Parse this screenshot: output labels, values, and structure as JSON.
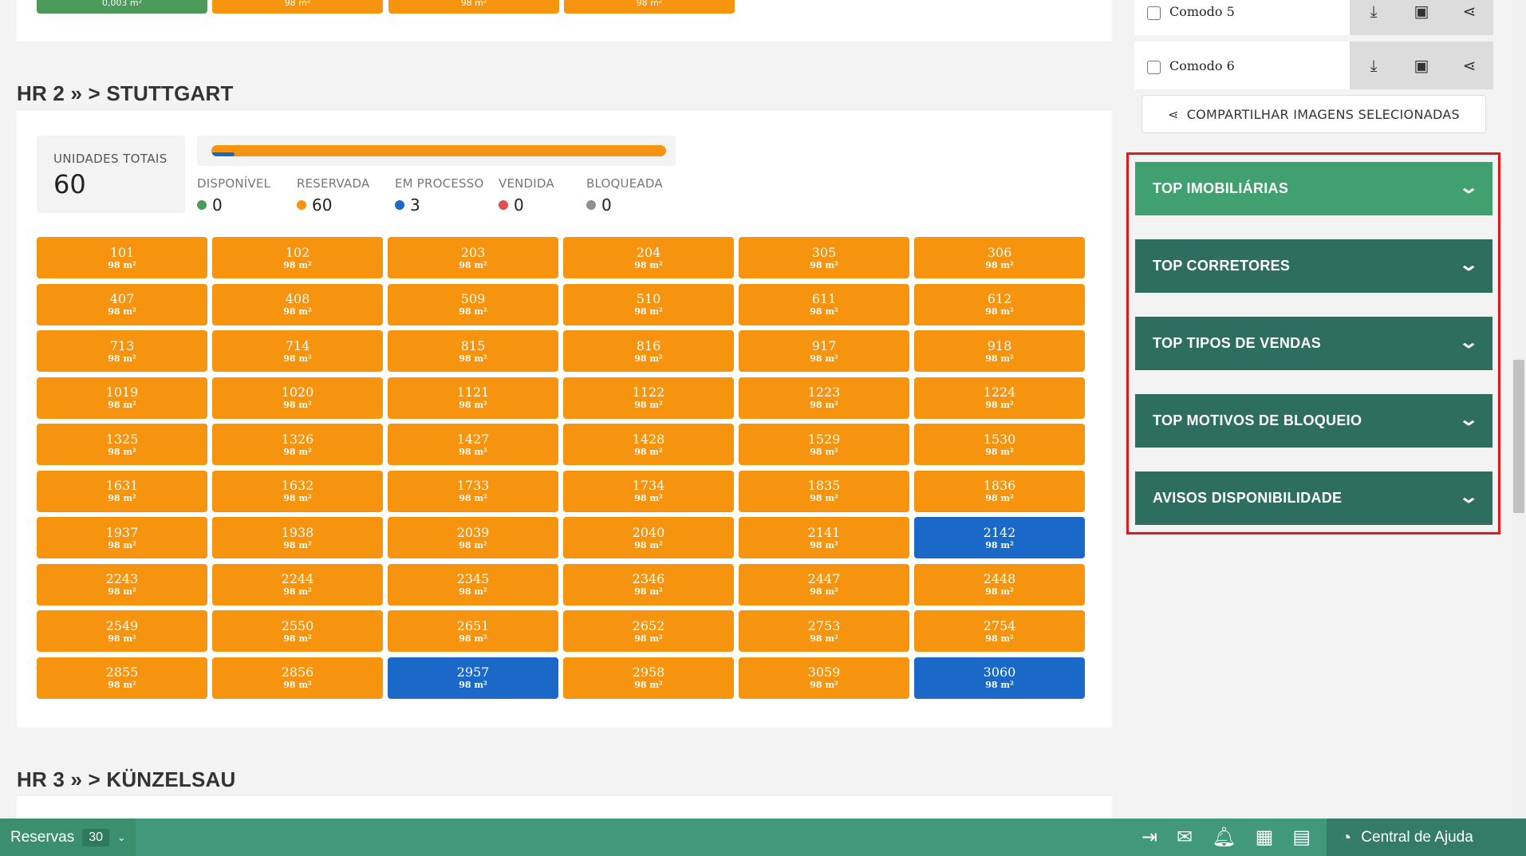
{
  "top_remnant": {
    "units": [
      {
        "area": "0,003 m²",
        "color": "green"
      },
      {
        "area": "98 m²",
        "color": "orange"
      },
      {
        "area": "98 m²",
        "color": "orange"
      },
      {
        "area": "98 m²",
        "color": "orange"
      }
    ]
  },
  "section_hr2": {
    "title": "HR 2 » > STUTTGART"
  },
  "totals": {
    "label": "UNIDADES TOTAIS",
    "value": "60"
  },
  "progress": {
    "reservada_fraction": 1.0,
    "em_processo_fraction": 0.05
  },
  "stats": [
    {
      "label": "DISPONÍVEL",
      "value": "0",
      "color": "#4c9a59"
    },
    {
      "label": "RESERVADA",
      "value": "60",
      "color": "#f6940f"
    },
    {
      "label": "EM PROCESSO",
      "value": "3",
      "color": "#1a69c9"
    },
    {
      "label": "VENDIDA",
      "value": "0",
      "color": "#e04f4f"
    },
    {
      "label": "BLOQUEADA",
      "value": "0",
      "color": "#8e8e8e"
    }
  ],
  "units": [
    {
      "num": "101",
      "area": "98 m²",
      "status": "reservada"
    },
    {
      "num": "102",
      "area": "98 m²",
      "status": "reservada"
    },
    {
      "num": "203",
      "area": "98 m²",
      "status": "reservada"
    },
    {
      "num": "204",
      "area": "98 m²",
      "status": "reservada"
    },
    {
      "num": "305",
      "area": "98 m²",
      "status": "reservada"
    },
    {
      "num": "306",
      "area": "98 m²",
      "status": "reservada"
    },
    {
      "num": "407",
      "area": "98 m²",
      "status": "reservada"
    },
    {
      "num": "408",
      "area": "98 m²",
      "status": "reservada"
    },
    {
      "num": "509",
      "area": "98 m²",
      "status": "reservada"
    },
    {
      "num": "510",
      "area": "98 m²",
      "status": "reservada"
    },
    {
      "num": "611",
      "area": "98 m²",
      "status": "reservada"
    },
    {
      "num": "612",
      "area": "98 m²",
      "status": "reservada"
    },
    {
      "num": "713",
      "area": "98 m²",
      "status": "reservada"
    },
    {
      "num": "714",
      "area": "98 m²",
      "status": "reservada"
    },
    {
      "num": "815",
      "area": "98 m²",
      "status": "reservada"
    },
    {
      "num": "816",
      "area": "98 m²",
      "status": "reservada"
    },
    {
      "num": "917",
      "area": "98 m²",
      "status": "reservada"
    },
    {
      "num": "918",
      "area": "98 m²",
      "status": "reservada"
    },
    {
      "num": "1019",
      "area": "98 m²",
      "status": "reservada"
    },
    {
      "num": "1020",
      "area": "98 m²",
      "status": "reservada"
    },
    {
      "num": "1121",
      "area": "98 m²",
      "status": "reservada"
    },
    {
      "num": "1122",
      "area": "98 m²",
      "status": "reservada"
    },
    {
      "num": "1223",
      "area": "98 m²",
      "status": "reservada"
    },
    {
      "num": "1224",
      "area": "98 m²",
      "status": "reservada"
    },
    {
      "num": "1325",
      "area": "98 m²",
      "status": "reservada"
    },
    {
      "num": "1326",
      "area": "98 m²",
      "status": "reservada"
    },
    {
      "num": "1427",
      "area": "98 m²",
      "status": "reservada"
    },
    {
      "num": "1428",
      "area": "98 m²",
      "status": "reservada"
    },
    {
      "num": "1529",
      "area": "98 m²",
      "status": "reservada"
    },
    {
      "num": "1530",
      "area": "98 m²",
      "status": "reservada"
    },
    {
      "num": "1631",
      "area": "98 m²",
      "status": "reservada"
    },
    {
      "num": "1632",
      "area": "98 m²",
      "status": "reservada"
    },
    {
      "num": "1733",
      "area": "98 m²",
      "status": "reservada"
    },
    {
      "num": "1734",
      "area": "98 m²",
      "status": "reservada"
    },
    {
      "num": "1835",
      "area": "98 m²",
      "status": "reservada"
    },
    {
      "num": "1836",
      "area": "98 m²",
      "status": "reservada"
    },
    {
      "num": "1937",
      "area": "98 m²",
      "status": "reservada"
    },
    {
      "num": "1938",
      "area": "98 m²",
      "status": "reservada"
    },
    {
      "num": "2039",
      "area": "98 m²",
      "status": "reservada"
    },
    {
      "num": "2040",
      "area": "98 m²",
      "status": "reservada"
    },
    {
      "num": "2141",
      "area": "98 m²",
      "status": "reservada"
    },
    {
      "num": "2142",
      "area": "98 m²",
      "status": "em_processo"
    },
    {
      "num": "2243",
      "area": "98 m²",
      "status": "reservada"
    },
    {
      "num": "2244",
      "area": "98 m²",
      "status": "reservada"
    },
    {
      "num": "2345",
      "area": "98 m²",
      "status": "reservada"
    },
    {
      "num": "2346",
      "area": "98 m²",
      "status": "reservada"
    },
    {
      "num": "2447",
      "area": "98 m²",
      "status": "reservada"
    },
    {
      "num": "2448",
      "area": "98 m²",
      "status": "reservada"
    },
    {
      "num": "2549",
      "area": "98 m²",
      "status": "reservada"
    },
    {
      "num": "2550",
      "area": "98 m²",
      "status": "reservada"
    },
    {
      "num": "2651",
      "area": "98 m²",
      "status": "reservada"
    },
    {
      "num": "2652",
      "area": "98 m²",
      "status": "reservada"
    },
    {
      "num": "2753",
      "area": "98 m²",
      "status": "reservada"
    },
    {
      "num": "2754",
      "area": "98 m²",
      "status": "reservada"
    },
    {
      "num": "2855",
      "area": "98 m²",
      "status": "reservada"
    },
    {
      "num": "2856",
      "area": "98 m²",
      "status": "reservada"
    },
    {
      "num": "2957",
      "area": "98 m²",
      "status": "em_processo"
    },
    {
      "num": "2958",
      "area": "98 m²",
      "status": "reservada"
    },
    {
      "num": "3059",
      "area": "98 m²",
      "status": "reservada"
    },
    {
      "num": "3060",
      "area": "98 m²",
      "status": "em_processo"
    }
  ],
  "section_hr3": {
    "title": "HR 3 » > KÜNZELSAU"
  },
  "rooms": [
    {
      "name": "Comodo 5"
    },
    {
      "name": "Comodo 6"
    }
  ],
  "room_actions": {
    "download_icon": "download-icon",
    "image_icon": "image-icon",
    "share_icon": "share-icon"
  },
  "share_button": {
    "label": "COMPARTILHAR IMAGENS SELECIONADAS"
  },
  "accordions": [
    {
      "label": "TOP IMOBILIÁRIAS",
      "active": true
    },
    {
      "label": "TOP CORRETORES",
      "active": false
    },
    {
      "label": "TOP TIPOS DE VENDAS",
      "active": false
    },
    {
      "label": "TOP MOTIVOS DE BLOQUEIO",
      "active": false
    },
    {
      "label": "AVISOS DISPONIBILIDADE",
      "active": false
    }
  ],
  "bottom_bar": {
    "reservas_label": "Reservas",
    "reservas_count": "30",
    "help_label": "Central de Ajuda"
  },
  "colors": {
    "reservada": "#f6940f",
    "em_processo": "#1a69c9",
    "accordion": "#2d6e5e",
    "accordion_active": "#41a06f",
    "bottom_bar": "#41987a"
  }
}
